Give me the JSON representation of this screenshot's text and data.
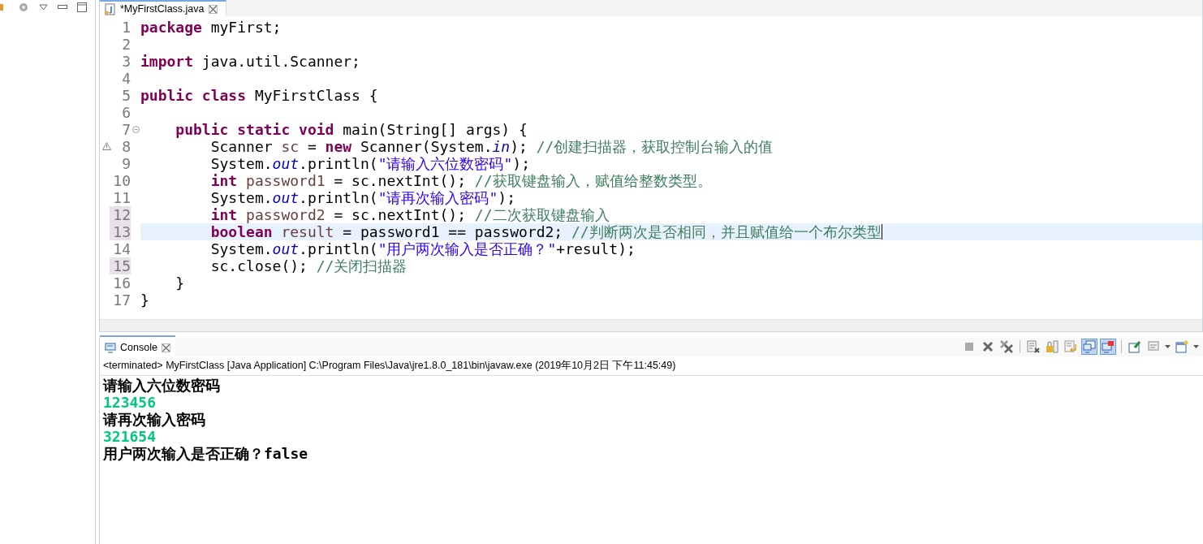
{
  "left_panel": {
    "toolbar": [
      {
        "kind": "gear"
      },
      {
        "kind": "menu"
      },
      {
        "kind": "minimize"
      },
      {
        "kind": "maximize"
      }
    ]
  },
  "editor": {
    "tab": {
      "title": "*MyFirstClass.java",
      "selected": true
    },
    "lines": [
      {
        "number": "1",
        "marked": false,
        "current": false,
        "fold": false,
        "warning": false,
        "tokens": [
          {
            "kind": "kw",
            "text": "package"
          },
          {
            "kind": "id",
            "text": " myFirst;"
          }
        ]
      },
      {
        "number": "2",
        "marked": false,
        "current": false,
        "fold": false,
        "warning": false
      },
      {
        "number": "3",
        "marked": false,
        "current": false,
        "fold": false,
        "warning": false,
        "tokens": [
          {
            "kind": "kw",
            "text": "import"
          },
          {
            "kind": "id",
            "text": " java.util.Scanner;"
          }
        ]
      },
      {
        "number": "4",
        "marked": false,
        "current": false,
        "fold": false,
        "warning": false
      },
      {
        "number": "5",
        "marked": false,
        "current": false,
        "fold": false,
        "warning": false,
        "tokens": [
          {
            "kind": "kw",
            "text": "public class"
          },
          {
            "kind": "id",
            "text": " MyFirstClass {"
          }
        ]
      },
      {
        "number": "6",
        "marked": false,
        "current": false,
        "fold": false,
        "warning": false
      },
      {
        "number": "7",
        "marked": false,
        "current": false,
        "fold": true,
        "warning": false,
        "tokens": [
          {
            "kind": "kw",
            "text": "    public static void"
          },
          {
            "kind": "id",
            "text": " main(String[] args) {"
          }
        ]
      },
      {
        "number": "8",
        "marked": false,
        "current": false,
        "fold": false,
        "warning": true,
        "tokens": [
          {
            "kind": "id",
            "text": "        Scanner "
          },
          {
            "kind": "var",
            "text": "sc"
          },
          {
            "kind": "id",
            "text": " = "
          },
          {
            "kind": "kw",
            "text": "new"
          },
          {
            "kind": "id",
            "text": " Scanner(System."
          },
          {
            "kind": "field",
            "text": "in"
          },
          {
            "kind": "id",
            "text": "); "
          },
          {
            "kind": "com",
            "text": "//创建扫描器，获取控制台输入的值"
          }
        ]
      },
      {
        "number": "9",
        "marked": false,
        "current": false,
        "fold": false,
        "warning": false,
        "tokens": [
          {
            "kind": "id",
            "text": "        System."
          },
          {
            "kind": "field",
            "text": "out"
          },
          {
            "kind": "id",
            "text": ".println("
          },
          {
            "kind": "str",
            "text": "\"请输入六位数密码\""
          },
          {
            "kind": "id",
            "text": ");"
          }
        ]
      },
      {
        "number": "10",
        "marked": false,
        "current": false,
        "fold": false,
        "warning": false,
        "tokens": [
          {
            "kind": "kw",
            "text": "        int"
          },
          {
            "kind": "var",
            "text": " password1"
          },
          {
            "kind": "id",
            "text": " = sc.nextInt(); "
          },
          {
            "kind": "com",
            "text": "//获取键盘输入，赋值给整数类型。"
          }
        ]
      },
      {
        "number": "11",
        "marked": false,
        "current": false,
        "fold": false,
        "warning": false,
        "tokens": [
          {
            "kind": "id",
            "text": "        System."
          },
          {
            "kind": "field",
            "text": "out"
          },
          {
            "kind": "id",
            "text": ".println("
          },
          {
            "kind": "str",
            "text": "\"请再次输入密码\""
          },
          {
            "kind": "id",
            "text": ");"
          }
        ]
      },
      {
        "number": "12",
        "marked": true,
        "current": false,
        "fold": false,
        "warning": false,
        "tokens": [
          {
            "kind": "kw",
            "text": "        int"
          },
          {
            "kind": "var",
            "text": " password2"
          },
          {
            "kind": "id",
            "text": " = sc.nextInt(); "
          },
          {
            "kind": "com",
            "text": "//二次获取键盘输入"
          }
        ]
      },
      {
        "number": "13",
        "marked": true,
        "current": true,
        "fold": false,
        "warning": false,
        "tokens": [
          {
            "kind": "kw",
            "text": "        boolean"
          },
          {
            "kind": "var",
            "text": " result"
          },
          {
            "kind": "id",
            "text": " = password1 == password2; "
          },
          {
            "kind": "com",
            "text": "//判断两次是否相同，并且赋值给一个布尔类型"
          }
        ]
      },
      {
        "number": "14",
        "marked": false,
        "current": false,
        "fold": false,
        "warning": false,
        "tokens": [
          {
            "kind": "id",
            "text": "        System."
          },
          {
            "kind": "field",
            "text": "out"
          },
          {
            "kind": "id",
            "text": ".println("
          },
          {
            "kind": "str",
            "text": "\"用户两次输入是否正确？\""
          },
          {
            "kind": "id",
            "text": "+result);"
          }
        ]
      },
      {
        "number": "15",
        "marked": true,
        "current": false,
        "fold": false,
        "warning": false,
        "tokens": [
          {
            "kind": "id",
            "text": "        sc.close(); "
          },
          {
            "kind": "com",
            "text": "//关闭扫描器"
          }
        ]
      },
      {
        "number": "16",
        "marked": false,
        "current": false,
        "fold": false,
        "warning": false,
        "tokens": [
          {
            "kind": "id",
            "text": "    }"
          }
        ]
      },
      {
        "number": "17",
        "marked": false,
        "current": false,
        "fold": false,
        "warning": false,
        "tokens": [
          {
            "kind": "id",
            "text": "}"
          }
        ]
      }
    ]
  },
  "console": {
    "tab": {
      "title": "Console",
      "selected": true
    },
    "toolbar": [
      {
        "kind": "terminate",
        "selected": false
      },
      {
        "kind": "remove",
        "selected": false
      },
      {
        "kind": "remove-all",
        "selected": false
      },
      {
        "kind": "sep"
      },
      {
        "kind": "clear",
        "selected": false
      },
      {
        "kind": "lock",
        "selected": false
      },
      {
        "kind": "wrap",
        "selected": false
      },
      {
        "kind": "stdout",
        "selected": true
      },
      {
        "kind": "stderr",
        "selected": true
      },
      {
        "kind": "sep"
      },
      {
        "kind": "pin",
        "selected": false
      },
      {
        "kind": "display",
        "selected": false
      },
      {
        "kind": "caret",
        "selected": false
      },
      {
        "kind": "open",
        "selected": false
      },
      {
        "kind": "caret",
        "selected": false
      }
    ],
    "status": "<terminated> MyFirstClass [Java Application] C:\\Program Files\\Java\\jre1.8.0_181\\bin\\javaw.exe (2019年10月2日 下午11:45:49)",
    "output": [
      {
        "kind": "out",
        "text": "请输入六位数密码"
      },
      {
        "kind": "in",
        "text": "123456"
      },
      {
        "kind": "out",
        "text": "请再次输入密码"
      },
      {
        "kind": "in",
        "text": "321654"
      },
      {
        "kind": "out",
        "text": "用户两次输入是否正确？false"
      }
    ]
  }
}
